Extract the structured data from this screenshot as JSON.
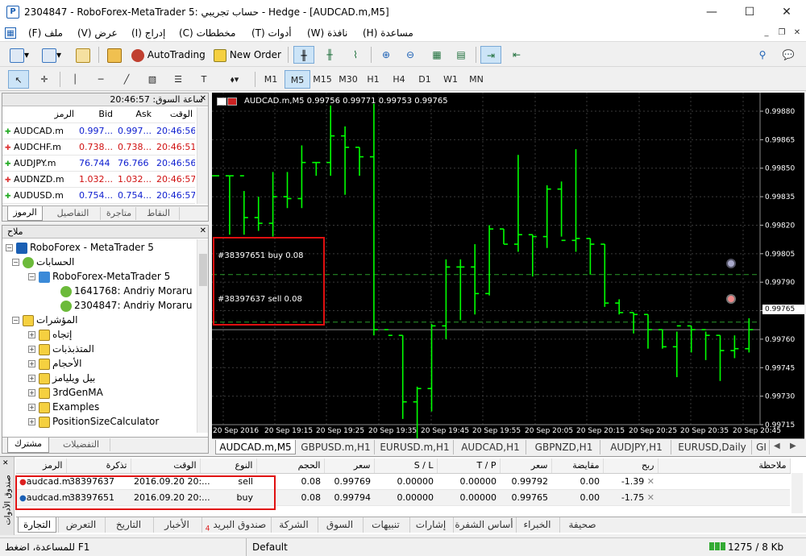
{
  "window": {
    "title": "2304847 - RoboForex-MetaTrader 5: حساب تجريبي - Hedge - [AUDCAD.m,M5]",
    "minimize": "—",
    "maximize": "☐",
    "close": "✕"
  },
  "menu": [
    {
      "label": "ملف",
      "key": "(F)"
    },
    {
      "label": "عرض",
      "key": "(V)"
    },
    {
      "label": "إدراج",
      "key": "(I)"
    },
    {
      "label": "مخططات",
      "key": "(C)"
    },
    {
      "label": "أدوات",
      "key": "(T)"
    },
    {
      "label": "نافذة",
      "key": "(W)"
    },
    {
      "label": "مساعدة",
      "key": "(H)"
    }
  ],
  "toolbar": {
    "autotrading": "AutoTrading",
    "new_order": "New Order"
  },
  "timeframes": [
    "M1",
    "M5",
    "M15",
    "M30",
    "H1",
    "H4",
    "D1",
    "W1",
    "MN"
  ],
  "active_timeframe": "M5",
  "market_watch": {
    "header": "ساعة السوق: 20:46:57",
    "columns": {
      "symbol": "الرمز",
      "bid": "Bid",
      "ask": "Ask",
      "time": "الوقت"
    },
    "rows": [
      {
        "symbol": "AUDCAD.m",
        "bid": "0.997...",
        "ask": "0.997...",
        "time": "20:46:56",
        "dir": "up",
        "color": "blue"
      },
      {
        "symbol": "AUDCHF.m",
        "bid": "0.738...",
        "ask": "0.738...",
        "time": "20:46:51",
        "dir": "down",
        "color": "red"
      },
      {
        "symbol": "AUDJPY.m",
        "bid": "76.744",
        "ask": "76.766",
        "time": "20:46:56",
        "dir": "up",
        "color": "blue"
      },
      {
        "symbol": "AUDNZD.m",
        "bid": "1.032...",
        "ask": "1.032...",
        "time": "20:46:57",
        "dir": "down",
        "color": "red"
      },
      {
        "symbol": "AUDUSD.m",
        "bid": "0.754...",
        "ask": "0.754...",
        "time": "20:46:57",
        "dir": "up",
        "color": "blue"
      }
    ],
    "tabs": [
      "الرموز",
      "التفاصيل",
      "متاجرة",
      "النقاط"
    ]
  },
  "navigator": {
    "header": "ملاح",
    "items": [
      {
        "label": "RoboForex - MetaTrader 5",
        "level": 0
      },
      {
        "label": "الحسابات",
        "level": 1
      },
      {
        "label": "RoboForex-MetaTrader 5",
        "level": 2
      },
      {
        "label": "1641768: Andriy Moraru",
        "level": 3
      },
      {
        "label": "2304847: Andriy Moraru",
        "level": 3
      },
      {
        "label": "المؤشرات",
        "level": 1
      },
      {
        "label": "إتجاه",
        "level": 2
      },
      {
        "label": "المتذبذبات",
        "level": 2
      },
      {
        "label": "الأحجام",
        "level": 2
      },
      {
        "label": "بيل ويليامز",
        "level": 2
      },
      {
        "label": "3rdGenMA",
        "level": 2
      },
      {
        "label": "Examples",
        "level": 2
      },
      {
        "label": "PositionSizeCalculator",
        "level": 2
      }
    ],
    "tabs": [
      "مشترك",
      "التفضيلات"
    ]
  },
  "chart": {
    "info": "AUDCAD.m,M5  0.99756 0.99771 0.99753 0.99765",
    "price_label": "0.99765",
    "y_ticks": [
      "0.99880",
      "0.99865",
      "0.99850",
      "0.99835",
      "0.99820",
      "0.99805",
      "0.99790",
      "0.99775",
      "0.99760",
      "0.99745",
      "0.99730",
      "0.99715"
    ],
    "x_ticks": [
      "20 Sep 2016",
      "20 Sep 19:15",
      "20 Sep 19:25",
      "20 Sep 19:35",
      "20 Sep 19:45",
      "20 Sep 19:55",
      "20 Sep 20:05",
      "20 Sep 20:15",
      "20 Sep 20:25",
      "20 Sep 20:35",
      "20 Sep 20:45"
    ],
    "buy_line": "#38397651 buy 0.08",
    "sell_line": "#38397637 sell 0.08",
    "bar_color": "#00ff00"
  },
  "chart_tabs": [
    "AUDCAD.m,M5",
    "GBPUSD.m,H1",
    "EURUSD.m,H1",
    "AUDCAD,H1",
    "GBPNZD,H1",
    "AUDJPY,H1",
    "EURUSD,Daily",
    "GI"
  ],
  "trade": {
    "columns": [
      "الرمز",
      "تذكرة",
      "الوقت",
      "النوع",
      "الحجم",
      "سعر",
      "S / L",
      "T / P",
      "سعر",
      "مقايضة",
      "ربح",
      "ملاحظة"
    ],
    "rows": [
      {
        "symbol": "audcad.m",
        "ticket": "38397637",
        "time": "2016.09.20 20:...",
        "type": "sell",
        "volume": "0.08",
        "price": "0.99769",
        "sl": "0.00000",
        "tp": "0.00000",
        "cur_price": "0.99792",
        "swap": "0.00",
        "profit": "-1.39"
      },
      {
        "symbol": "audcad.m",
        "ticket": "38397651",
        "time": "2016.09.20 20:...",
        "type": "buy",
        "volume": "0.08",
        "price": "0.99794",
        "sl": "0.00000",
        "tp": "0.00000",
        "cur_price": "0.99765",
        "swap": "0.00",
        "profit": "-1.75"
      }
    ],
    "side_label": "صندوق الأدوات"
  },
  "bottom_tabs": [
    "التجارة",
    "التعرض",
    "التاريخ",
    "الأخبار",
    "صندوق البريد",
    "الشركة",
    "السوق",
    "تنبيهات",
    "إشارات",
    "أساس الشفرة",
    "الخبراء",
    "صحيفة"
  ],
  "mailbox_count": "4",
  "status": {
    "help": "للمساعدة، اضغط F1",
    "profile": "Default",
    "traffic": "1275 / 8 Kb"
  }
}
